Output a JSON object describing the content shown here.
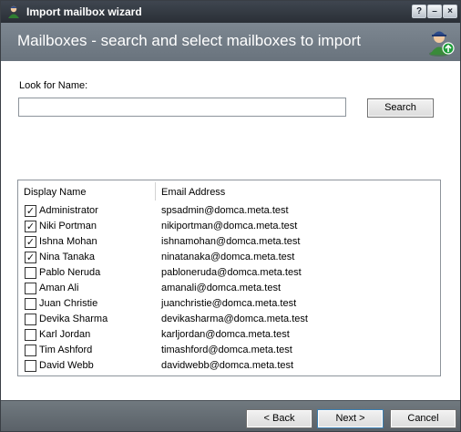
{
  "window": {
    "title": "Import mailbox wizard"
  },
  "header": {
    "title": "Mailboxes - search and select mailboxes to import"
  },
  "search": {
    "label": "Look for Name:",
    "value": "",
    "placeholder": "",
    "button_label": "Search"
  },
  "list": {
    "columns": [
      "Display Name",
      "Email Address"
    ],
    "rows": [
      {
        "name": "Administrator",
        "email": "spsadmin@domca.meta.test",
        "checked": true
      },
      {
        "name": "Niki Portman",
        "email": "nikiportman@domca.meta.test",
        "checked": true
      },
      {
        "name": "Ishna Mohan",
        "email": "ishnamohan@domca.meta.test",
        "checked": true
      },
      {
        "name": "Nina Tanaka",
        "email": "ninatanaka@domca.meta.test",
        "checked": true
      },
      {
        "name": "Pablo Neruda",
        "email": "pabloneruda@domca.meta.test",
        "checked": false
      },
      {
        "name": "Aman Ali",
        "email": "amanali@domca.meta.test",
        "checked": false
      },
      {
        "name": "Juan Christie",
        "email": "juanchristie@domca.meta.test",
        "checked": false
      },
      {
        "name": "Devika Sharma",
        "email": "devikasharma@domca.meta.test",
        "checked": false
      },
      {
        "name": "Karl Jordan",
        "email": "karljordan@domca.meta.test",
        "checked": false
      },
      {
        "name": "Tim Ashford",
        "email": "timashford@domca.meta.test",
        "checked": false
      },
      {
        "name": "David Webb",
        "email": "davidwebb@domca.meta.test",
        "checked": false
      }
    ]
  },
  "footer": {
    "back_label": "< Back",
    "next_label": "Next >",
    "cancel_label": "Cancel"
  },
  "titlebar_buttons": {
    "help": "?",
    "minimize": "–",
    "close": "×"
  },
  "icons": {
    "app": "user-import-icon",
    "header": "user-add-icon"
  },
  "colors": {
    "titlebar": "#2f353c",
    "header": "#737d87",
    "footer": "#626a71",
    "next_focus": "#3c7fb1"
  }
}
